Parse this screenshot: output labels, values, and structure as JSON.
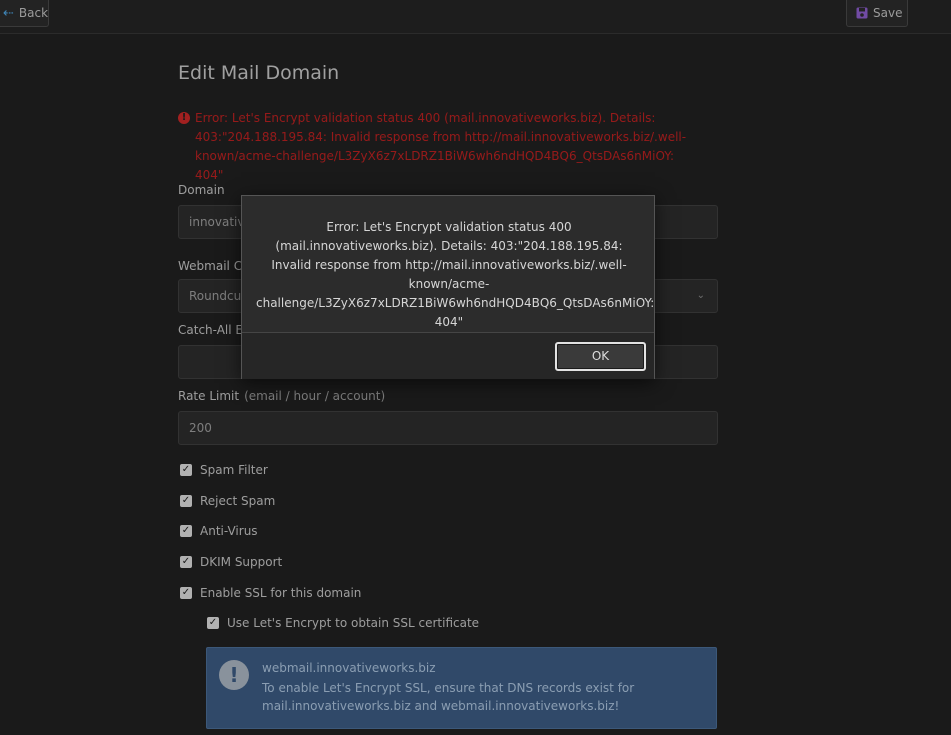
{
  "toolbar": {
    "back_label": "Back",
    "save_label": "Save"
  },
  "page": {
    "title": "Edit Mail Domain",
    "error_message": "Error: Let's Encrypt validation status 400 (mail.innovativeworks.biz). Details: 403:\"204.188.195.84: Invalid response from http://mail.innovativeworks.biz/.well-known/acme-challenge/L3ZyX6z7xLDRZ1BiW6wh6ndHQD4BQ6_QtsDAs6nMiOY: 404\""
  },
  "form": {
    "domain_label": "Domain",
    "domain_value": "innovative",
    "webmail_label": "Webmail Cl",
    "webmail_value": "Roundcub",
    "catchall_label": "Catch-All E",
    "catchall_value": "",
    "rate_limit_label": "Rate Limit",
    "rate_limit_sublabel": "(email / hour / account)",
    "rate_limit_value": "200"
  },
  "checkboxes": [
    {
      "label": "Spam Filter",
      "checked": true
    },
    {
      "label": "Reject Spam",
      "checked": true
    },
    {
      "label": "Anti-Virus",
      "checked": true
    },
    {
      "label": "DKIM Support",
      "checked": true
    },
    {
      "label": "Enable SSL for this domain",
      "checked": true
    },
    {
      "label": "Use Let's Encrypt to obtain SSL certificate",
      "checked": true
    }
  ],
  "info": {
    "title": "webmail.innovativeworks.biz",
    "text": "To enable Let's Encrypt SSL, ensure that DNS records exist for mail.innovativeworks.biz and webmail.innovativeworks.biz!"
  },
  "dialog": {
    "message": "Error: Let's Encrypt validation status 400 (mail.innovativeworks.biz). Details: 403:\"204.188.195.84: Invalid response from http://mail.innovativeworks.biz/.well-known/acme-challenge/L3ZyX6z7xLDRZ1BiW6wh6ndHQD4BQ6_QtsDAs6nMiOY: 404\"",
    "ok_label": "OK"
  },
  "colors": {
    "error": "#b82020",
    "info_bg": "#3b5a80",
    "back_accent": "#4da3e0",
    "save_accent": "#8a5cc8"
  }
}
